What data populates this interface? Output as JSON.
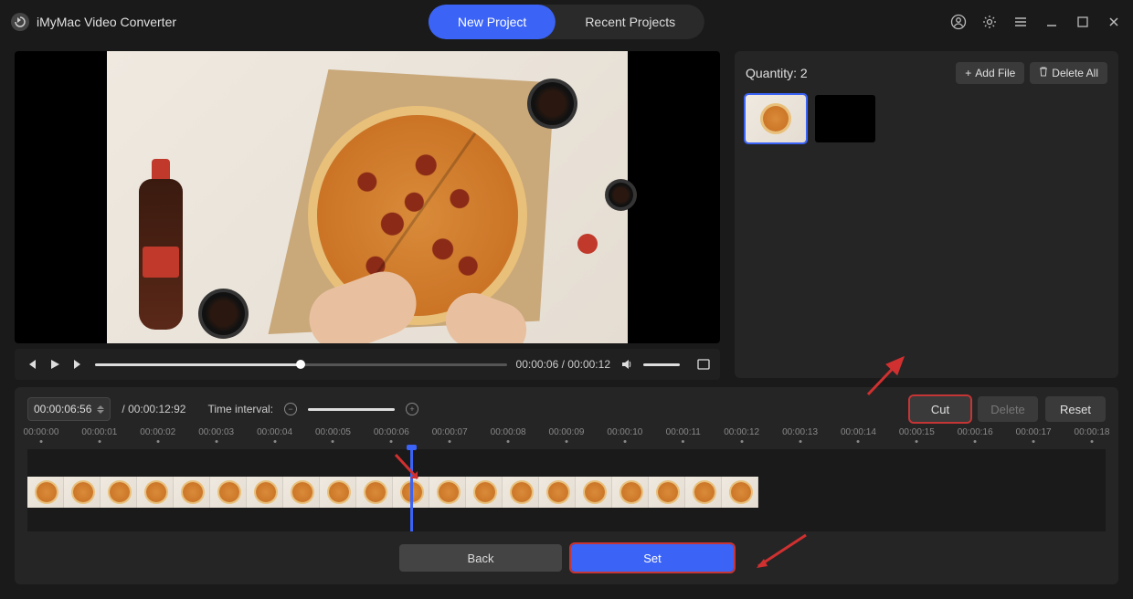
{
  "app": {
    "title": "iMyMac Video Converter"
  },
  "tabs": {
    "new_project": "New Project",
    "recent_projects": "Recent Projects"
  },
  "player": {
    "current_time": "00:00:06",
    "duration": "00:00:12"
  },
  "sidebar": {
    "quantity_label": "Quantity:",
    "quantity_value": "2",
    "add_file": "Add File",
    "delete_all": "Delete All"
  },
  "timeline": {
    "timecode": "00:00:06:56",
    "duration_full": "/ 00:00:12:92",
    "interval_label": "Time interval:",
    "actions": {
      "cut": "Cut",
      "delete": "Delete",
      "reset": "Reset"
    },
    "ruler": [
      "00:00:00",
      "00:00:01",
      "00:00:02",
      "00:00:03",
      "00:00:04",
      "00:00:05",
      "00:00:06",
      "00:00:07",
      "00:00:08",
      "00:00:09",
      "00:00:10",
      "00:00:11",
      "00:00:12",
      "00:00:13",
      "00:00:14",
      "00:00:15",
      "00:00:16",
      "00:00:17",
      "00:00:18"
    ]
  },
  "buttons": {
    "back": "Back",
    "set": "Set"
  }
}
